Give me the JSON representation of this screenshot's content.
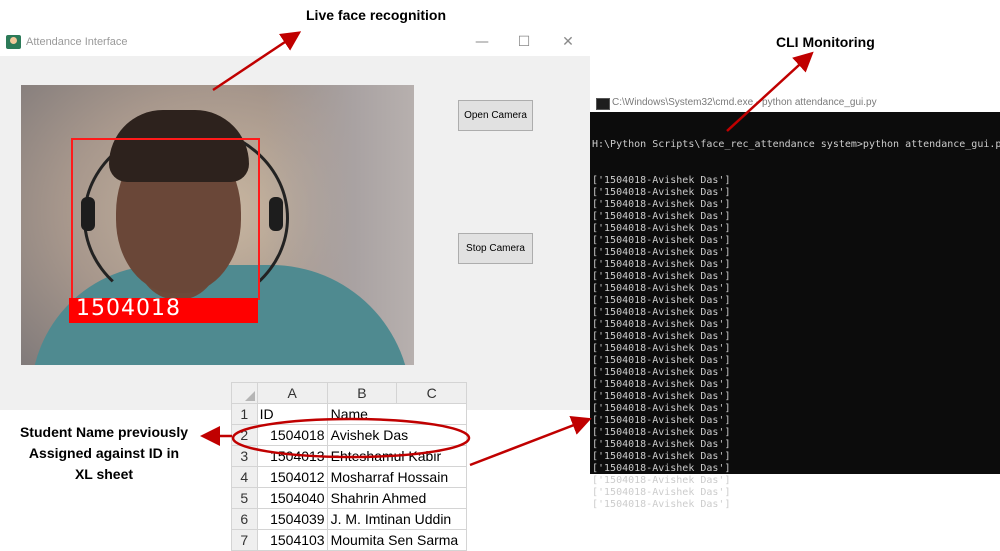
{
  "annotations": {
    "live_face": "Live face recognition",
    "cli_monitoring": "CLI Monitoring",
    "student_name_lines": [
      "Student Name previously",
      "Assigned against ID in",
      "XL sheet"
    ]
  },
  "attendance_window": {
    "title": "Attendance Interface",
    "minimize": "—",
    "maximize": "☐",
    "close": "✕",
    "face_label": "1504018",
    "open_camera": "Open Camera",
    "stop_camera": "Stop Camera"
  },
  "cli": {
    "title": "C:\\Windows\\System32\\cmd.exe - python  attendance_gui.py",
    "command": "H:\\Python Scripts\\face_rec_attendance system>python attendance_gui.py",
    "output_lines": [
      "['1504018-Avishek Das']",
      "['1504018-Avishek Das']",
      "['1504018-Avishek Das']",
      "['1504018-Avishek Das']",
      "['1504018-Avishek Das']",
      "['1504018-Avishek Das']",
      "['1504018-Avishek Das']",
      "['1504018-Avishek Das']",
      "['1504018-Avishek Das']",
      "['1504018-Avishek Das']",
      "['1504018-Avishek Das']",
      "['1504018-Avishek Das']",
      "['1504018-Avishek Das']",
      "['1504018-Avishek Das']",
      "['1504018-Avishek Das']",
      "['1504018-Avishek Das']",
      "['1504018-Avishek Das']",
      "['1504018-Avishek Das']",
      "['1504018-Avishek Das']",
      "['1504018-Avishek Das']",
      "['1504018-Avishek Das']",
      "['1504018-Avishek Das']",
      "['1504018-Avishek Das']",
      "['1504018-Avishek Das']",
      "['1504018-Avishek Das']",
      "['1504018-Avishek Das']",
      "['1504018-Avishek Das']",
      "['1504018-Avishek Das']"
    ]
  },
  "sheet": {
    "columns": [
      "A",
      "B",
      "C"
    ],
    "rows": [
      {
        "num": "1",
        "id": "ID",
        "name": "Name"
      },
      {
        "num": "2",
        "id": "1504018",
        "name": "Avishek Das"
      },
      {
        "num": "3",
        "id": "1504013",
        "name": "Ehteshamul Kabir"
      },
      {
        "num": "4",
        "id": "1504012",
        "name": "Mosharraf Hossain"
      },
      {
        "num": "5",
        "id": "1504040",
        "name": "Shahrin Ahmed"
      },
      {
        "num": "6",
        "id": "1504039",
        "name": "J. M. Imtinan Uddin"
      },
      {
        "num": "7",
        "id": "1504103",
        "name": "Moumita Sen Sarma"
      }
    ]
  },
  "colors": {
    "arrow": "#c00000",
    "face_box": "#ff0000",
    "console_bg": "#0c0c0c"
  }
}
